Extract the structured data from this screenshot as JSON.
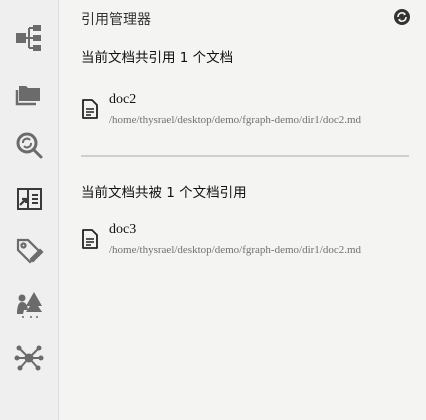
{
  "panel": {
    "title": "引用管理器"
  },
  "sections": [
    {
      "title": "当前文档共引用 1 个文档",
      "docs": [
        {
          "name": "doc2",
          "path": "/home/thysrael/desktop/demo/fgraph-demo/dir1/doc2.md"
        }
      ]
    },
    {
      "title": "当前文档共被 1 个文档引用",
      "docs": [
        {
          "name": "doc3",
          "path": "/home/thysrael/desktop/demo/fgraph-demo/dir1/doc2.md"
        }
      ]
    }
  ],
  "sidebar_icons": [
    "tree-icon",
    "folder-icon",
    "search-refresh-icon",
    "reference-icon",
    "tag-edit-icon",
    "people-forest-icon",
    "graph-icon"
  ],
  "colors": {
    "icon": "#6b6b6b",
    "background": "#f4f4f3",
    "divider": "#cfcfcf"
  }
}
